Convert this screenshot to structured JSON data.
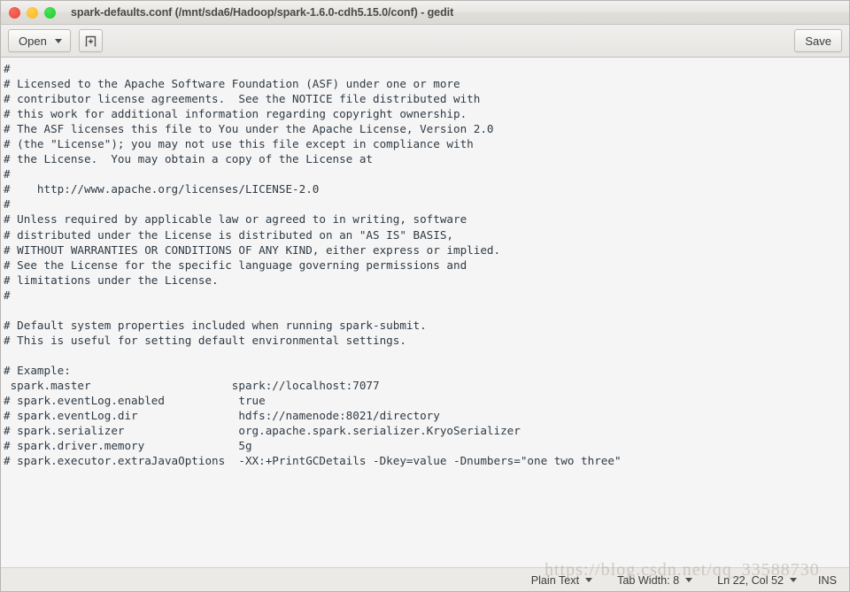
{
  "window": {
    "title": "spark-defaults.conf (/mnt/sda6/Hadoop/spark-1.6.0-cdh5.15.0/conf) - gedit",
    "controls": {
      "close": "close-button",
      "minimize": "minimize-button",
      "maximize": "maximize-button"
    },
    "colors": {
      "close": "#e8453b",
      "minimize": "#f5b91f",
      "maximize": "#17cf27",
      "titlebar_bg": "#e6e4e1",
      "toolbar_bg": "#ebe9e6",
      "editor_bg": "#f5f5f5",
      "statusbar_bg": "#eceae7",
      "text": "#2f3a44"
    }
  },
  "toolbar": {
    "open_label": "Open",
    "open_caret": "chevron-down-icon",
    "newtab_icon": "new-document-icon",
    "save_label": "Save"
  },
  "editor": {
    "content": "#\n# Licensed to the Apache Software Foundation (ASF) under one or more\n# contributor license agreements.  See the NOTICE file distributed with\n# this work for additional information regarding copyright ownership.\n# The ASF licenses this file to You under the Apache License, Version 2.0\n# (the \"License\"); you may not use this file except in compliance with\n# the License.  You may obtain a copy of the License at\n#\n#    http://www.apache.org/licenses/LICENSE-2.0\n#\n# Unless required by applicable law or agreed to in writing, software\n# distributed under the License is distributed on an \"AS IS\" BASIS,\n# WITHOUT WARRANTIES OR CONDITIONS OF ANY KIND, either express or implied.\n# See the License for the specific language governing permissions and\n# limitations under the License.\n#\n\n# Default system properties included when running spark-submit.\n# This is useful for setting default environmental settings.\n\n# Example:\n spark.master                     spark://localhost:7077\n# spark.eventLog.enabled           true\n# spark.eventLog.dir               hdfs://namenode:8021/directory\n# spark.serializer                 org.apache.spark.serializer.KryoSerializer\n# spark.driver.memory              5g\n# spark.executor.extraJavaOptions  -XX:+PrintGCDetails -Dkey=value -Dnumbers=\"one two three\""
  },
  "statusbar": {
    "language": "Plain Text",
    "tab_width": "Tab Width: 8",
    "position": "Ln 22, Col 52",
    "insert_mode": "INS"
  },
  "watermark": {
    "text": "https://blog.csdn.net/qq_33588730"
  }
}
